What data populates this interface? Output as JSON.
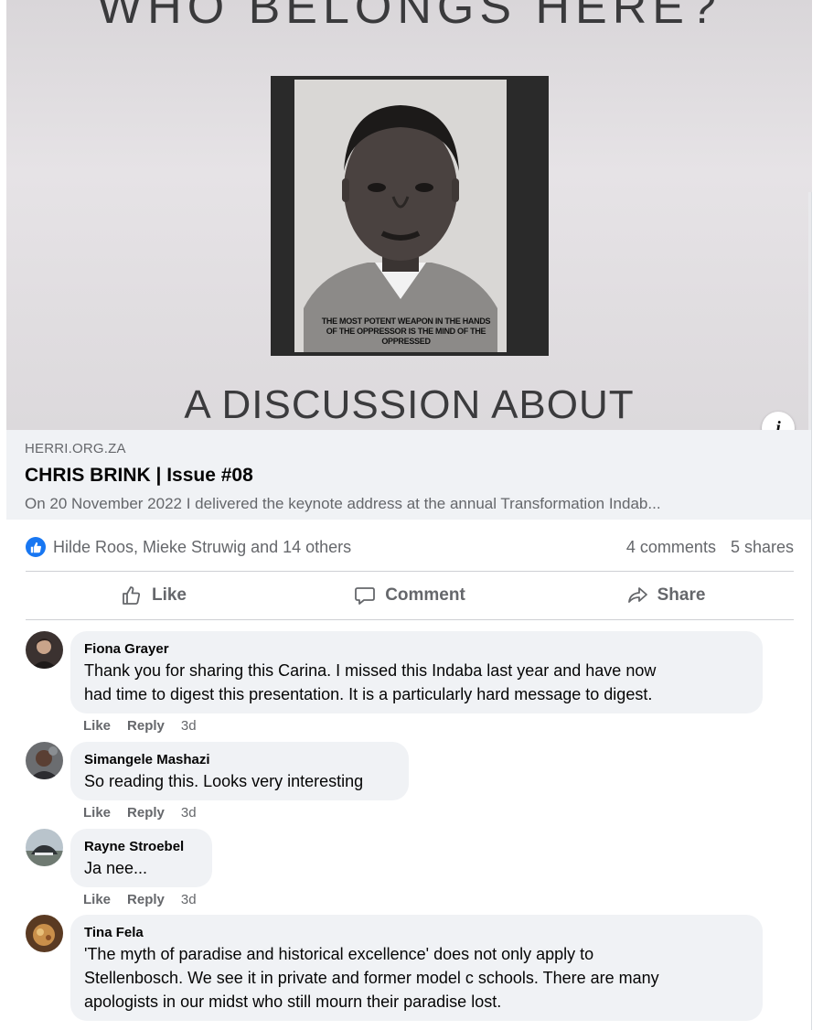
{
  "preview": {
    "poster_top_text": "WHO BELONGS HERE?",
    "poster_bottom_text": "A DISCUSSION ABOUT",
    "portrait_caption_line1": "THE MOST POTENT WEAPON IN THE HANDS",
    "portrait_caption_line2": "OF THE OPPRESSOR IS THE MIND OF THE OPPRESSED",
    "info_label": "i"
  },
  "link": {
    "domain": "HERRI.ORG.ZA",
    "title": "CHRIS BRINK | Issue #08",
    "description": "On 20 November 2022 I delivered the keynote address at the annual Transformation Indab..."
  },
  "reactions": {
    "text": "Hilde Roos, Mieke Struwig and 14 others",
    "comments_count": "4 comments",
    "shares_count": "5 shares",
    "icon": "thumbs-up-icon"
  },
  "actions": {
    "like": "Like",
    "comment": "Comment",
    "share": "Share"
  },
  "comments": [
    {
      "author": "Fiona Grayer",
      "text_lines": [
        "Thank you for sharing this Carina. I missed this Indaba last year and have now",
        "had time to digest this presentation. It is a particularly hard message to digest."
      ],
      "like": "Like",
      "reply": "Reply",
      "time": "3d"
    },
    {
      "author": "Simangele Mashazi",
      "text_lines": [
        "So reading this. Looks very interesting"
      ],
      "like": "Like",
      "reply": "Reply",
      "time": "3d"
    },
    {
      "author": "Rayne Stroebel",
      "text_lines": [
        "Ja nee..."
      ],
      "like": "Like",
      "reply": "Reply",
      "time": "3d"
    },
    {
      "author": "Tina Fela",
      "text_lines": [
        "'The myth of paradise and historical excellence' does not only apply to",
        "Stellenbosch. We see it in private and former model c schools. There are many",
        "apologists in our midst who still mourn their paradise lost."
      ],
      "like": "Like",
      "reply": "Reply",
      "time": "3d"
    }
  ]
}
